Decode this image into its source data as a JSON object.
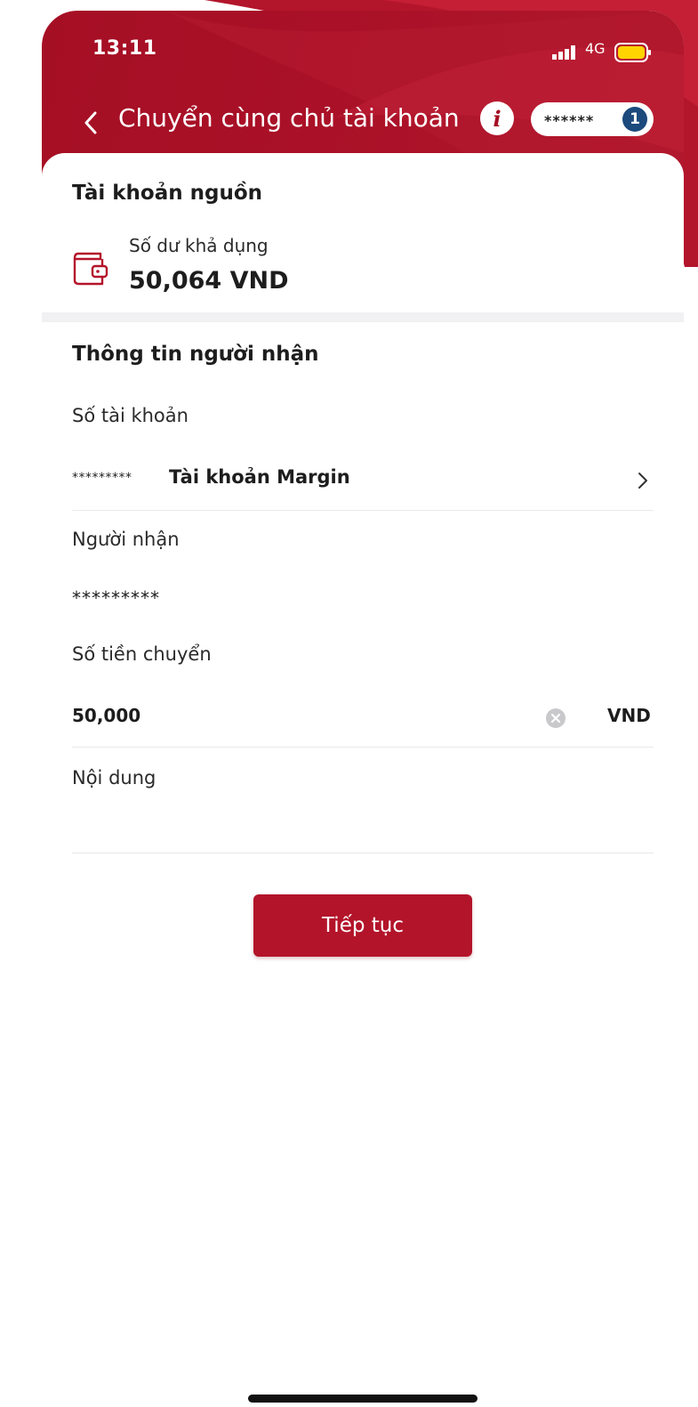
{
  "status_bar": {
    "time": "13:11",
    "network": "4G"
  },
  "nav": {
    "title": "Chuyển cùng chủ tài khoản",
    "info_glyph": "i",
    "account_masked": "******",
    "account_badge": "1"
  },
  "source": {
    "heading": "Tài khoản nguồn",
    "balance_label": "Số dư khả dụng",
    "balance_value": "50,064 VND"
  },
  "recipient": {
    "heading": "Thông tin người nhận",
    "account_label": "Số tài khoản",
    "account_number": "*********",
    "account_type": "Tài khoản Margin",
    "name_label": "Người nhận",
    "name_value": "*********"
  },
  "transfer": {
    "amount_label": "Số tiền chuyển",
    "amount_value": "50,000",
    "currency": "VND",
    "content_label": "Nội dung",
    "content_value": ""
  },
  "actions": {
    "continue_label": "Tiếp tục"
  },
  "colors": {
    "brand_red": "#a50f24",
    "button_red": "#b3142a",
    "badge_blue": "#1c4a7d",
    "battery_yellow": "#ffd400"
  },
  "icons": {
    "back": "chevron-left-icon",
    "info": "info-icon",
    "wallet": "wallet-icon",
    "account_row": "chevron-right-icon",
    "clear": "clear-icon"
  }
}
